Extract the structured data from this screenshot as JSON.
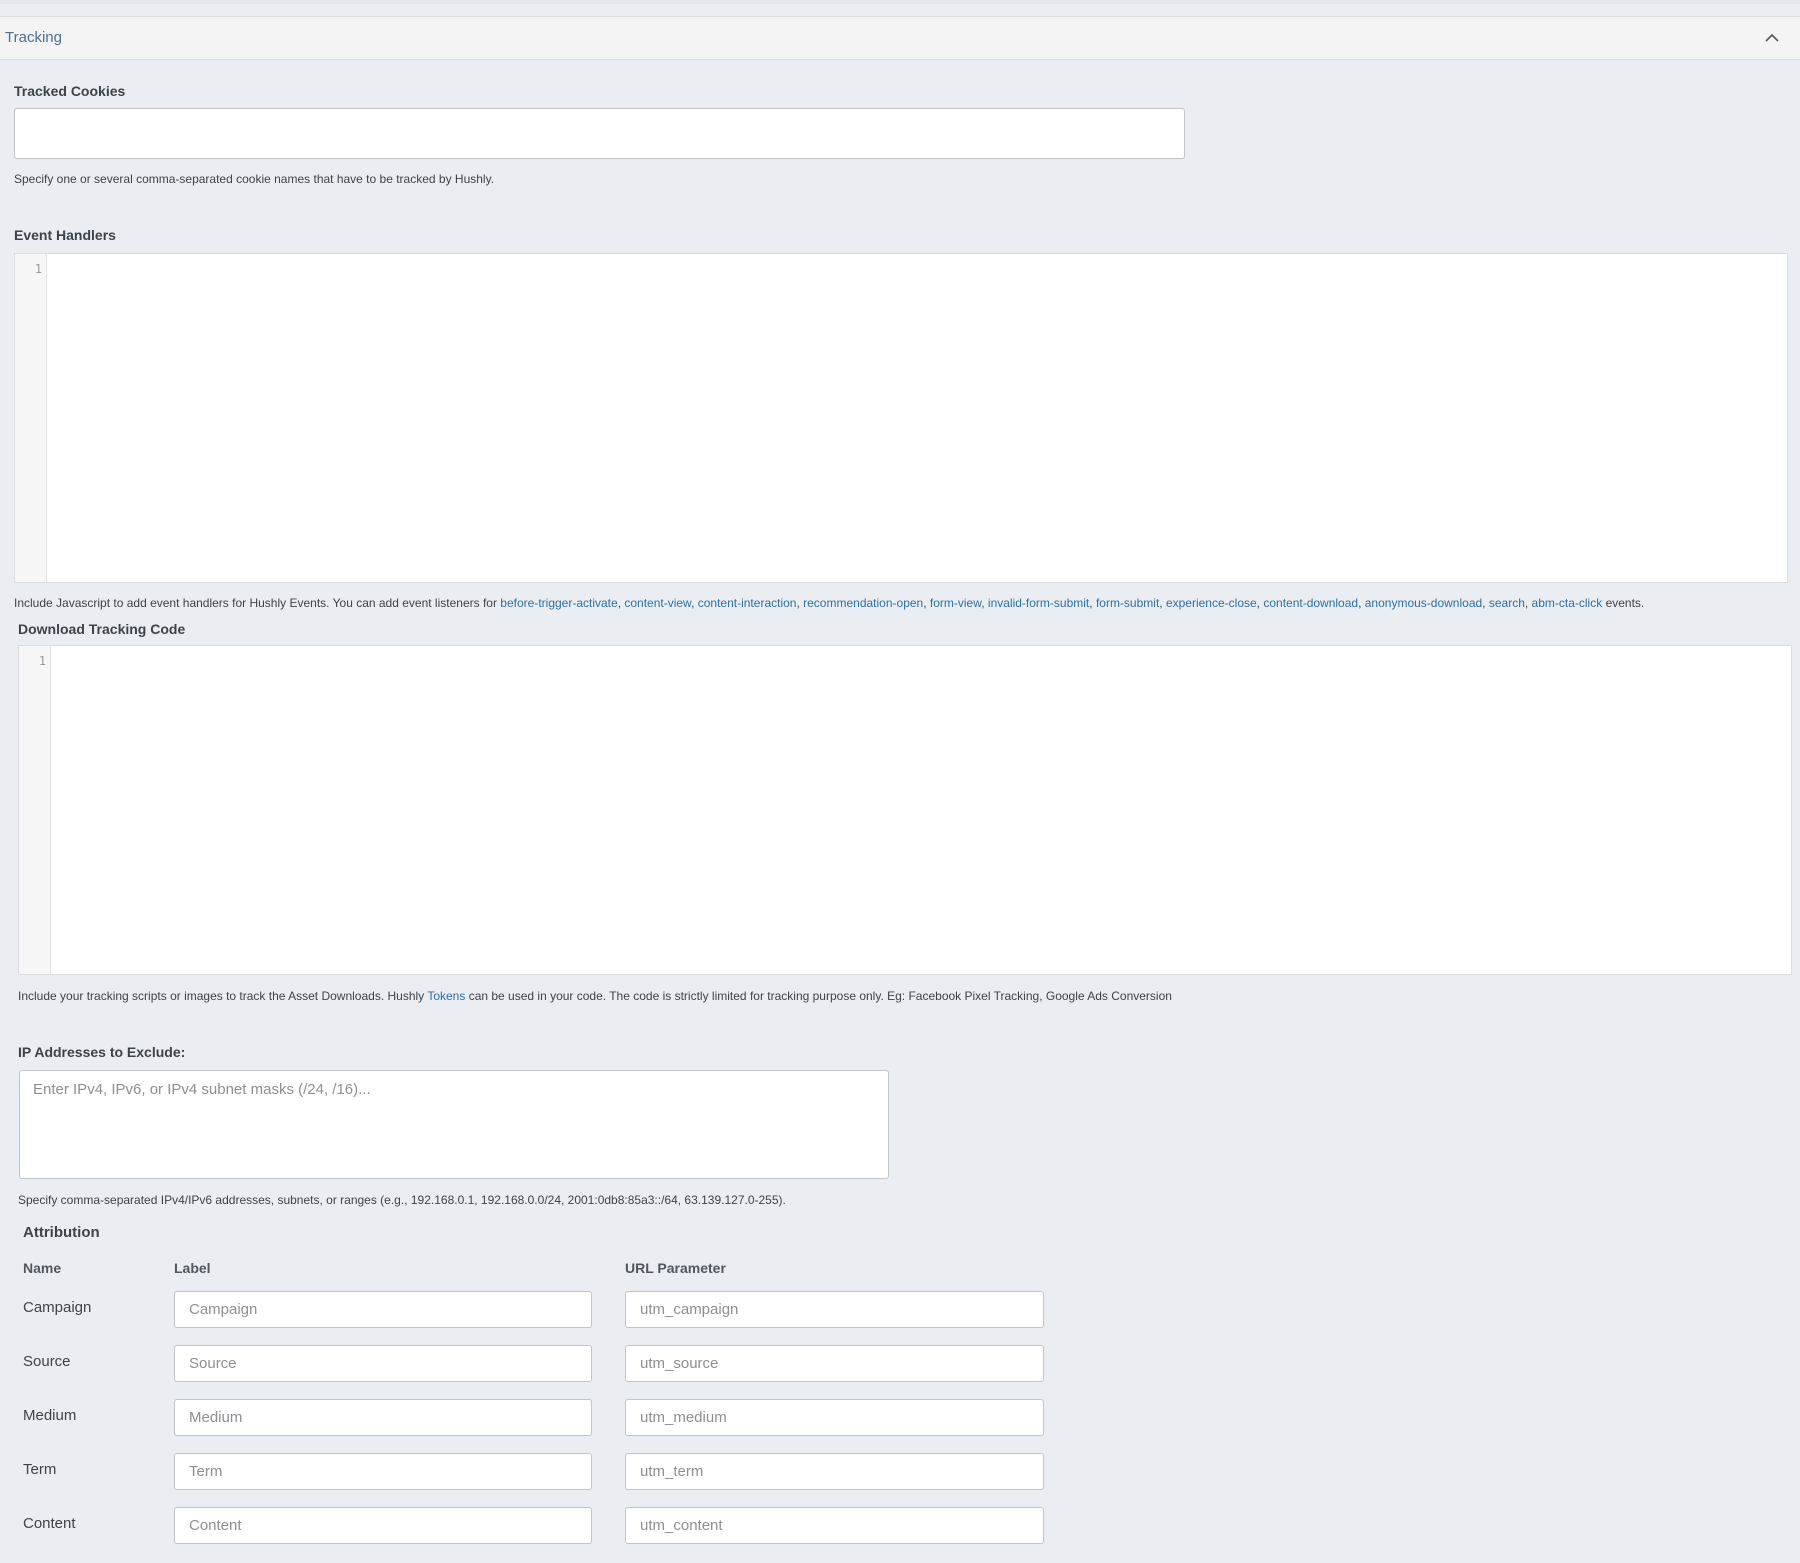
{
  "panel": {
    "title": "Tracking"
  },
  "tracked_cookies": {
    "label": "Tracked Cookies",
    "value": "",
    "help": "Specify one or several comma-separated cookie names that have to be tracked by Hushly."
  },
  "event_handlers": {
    "label": "Event Handlers",
    "line_number": "1",
    "help_prefix": "Include Javascript to add event handlers for Hushly Events. You can add event listeners for",
    "events": [
      "before-trigger-activate",
      "content-view",
      "content-interaction",
      "recommendation-open",
      "form-view",
      "invalid-form-submit",
      "form-submit",
      "experience-close",
      "content-download",
      "anonymous-download",
      "search",
      "abm-cta-click"
    ],
    "help_suffix": "events."
  },
  "download_tracking": {
    "label": "Download Tracking Code",
    "line_number": "1",
    "help_prefix": "Include your tracking scripts or images to track the Asset Downloads. Hushly",
    "help_link": "Tokens",
    "help_suffix": "can be used in your code. The code is strictly limited for tracking purpose only. Eg: Facebook Pixel Tracking, Google Ads Conversion"
  },
  "ip_exclude": {
    "label": "IP Addresses to Exclude:",
    "placeholder": "Enter IPv4, IPv6, or IPv4 subnet masks (/24, /16)...",
    "value": "",
    "help": "Specify comma-separated IPv4/IPv6 addresses, subnets, or ranges (e.g., 192.168.0.1, 192.168.0.0/24, 2001:0db8:85a3::/64, 63.139.127.0-255)."
  },
  "attribution": {
    "title": "Attribution",
    "col_name": "Name",
    "col_label": "Label",
    "col_param": "URL Parameter",
    "rows": [
      {
        "name": "Campaign",
        "label_placeholder": "Campaign",
        "param_placeholder": "utm_campaign"
      },
      {
        "name": "Source",
        "label_placeholder": "Source",
        "param_placeholder": "utm_source"
      },
      {
        "name": "Medium",
        "label_placeholder": "Medium",
        "param_placeholder": "utm_medium"
      },
      {
        "name": "Term",
        "label_placeholder": "Term",
        "param_placeholder": "utm_term"
      },
      {
        "name": "Content",
        "label_placeholder": "Content",
        "param_placeholder": "utm_content"
      }
    ]
  },
  "icons": {
    "collapse": "chevron-up-icon"
  },
  "colors": {
    "link": "#2f6fa3",
    "panel_title": "#4f6f8f",
    "background": "#eaeef3"
  }
}
